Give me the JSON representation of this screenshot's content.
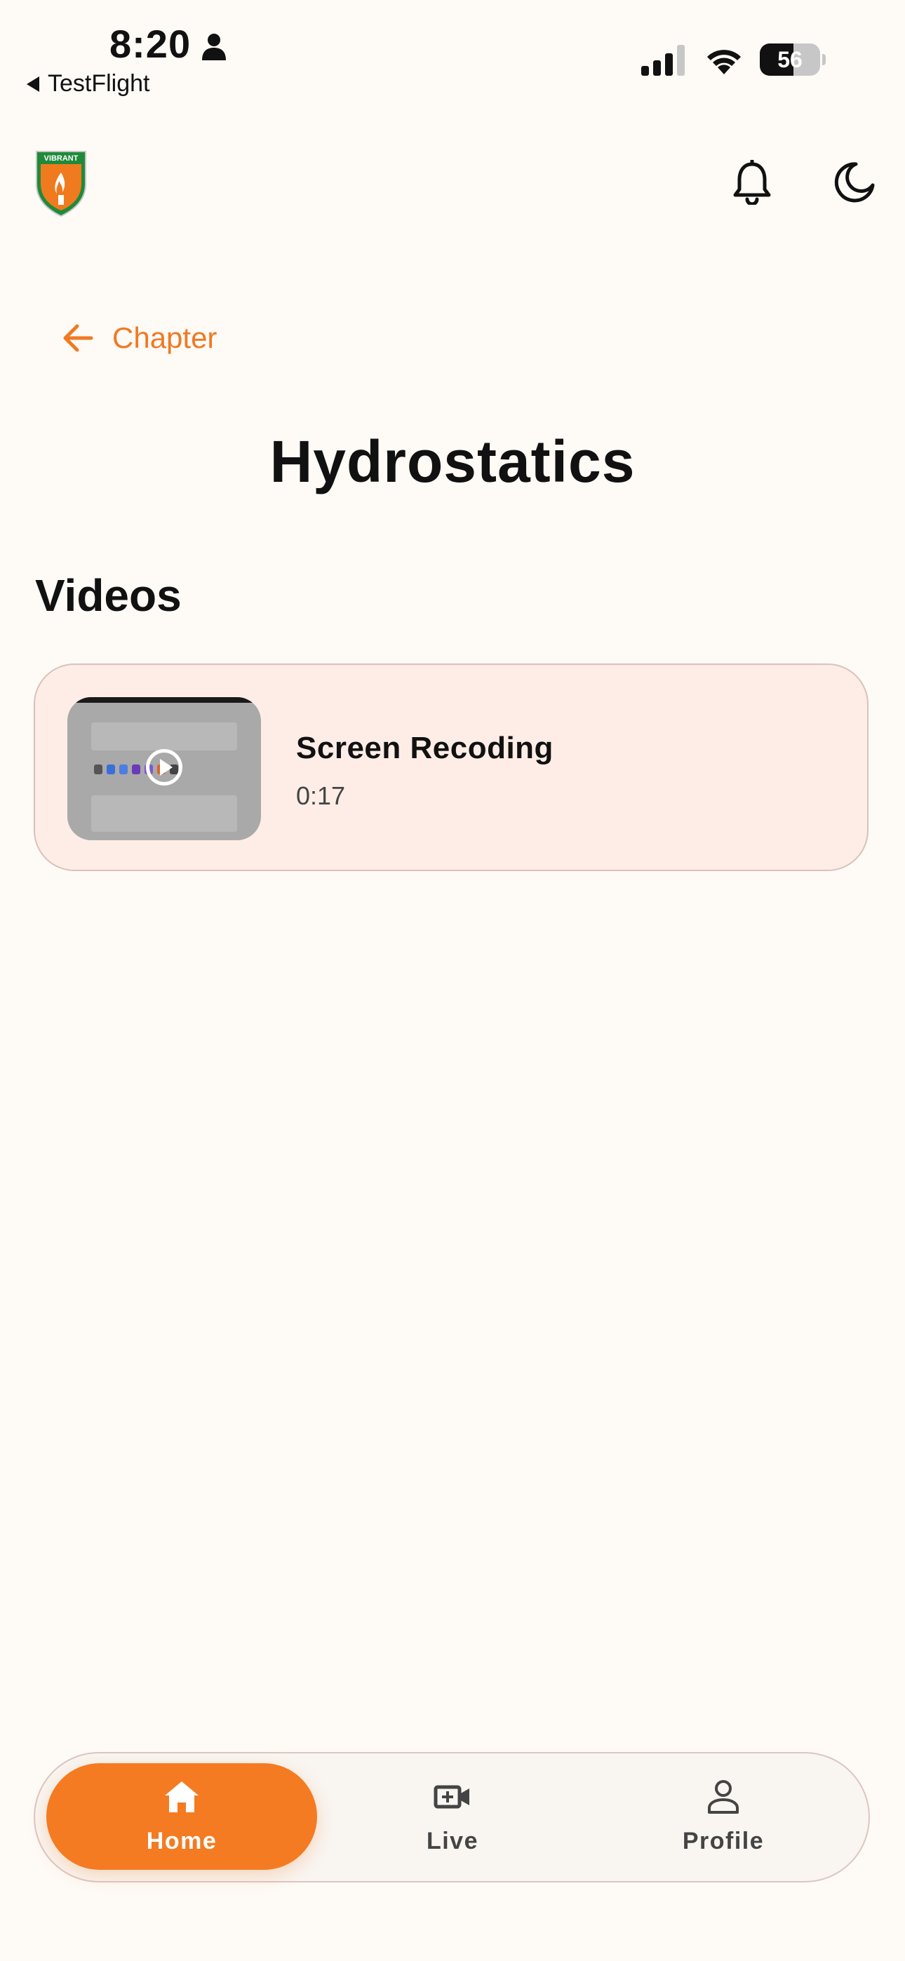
{
  "status_bar": {
    "time": "8:20",
    "back_app": "TestFlight",
    "battery_level": "56",
    "battery_fraction": 0.56
  },
  "header": {
    "logo_name": "vibrant-logo",
    "logo_text": "VIBRANT",
    "notification_icon": "bell-icon",
    "theme_icon": "moon-icon"
  },
  "back_link": {
    "label": "Chapter"
  },
  "page": {
    "title": "Hydrostatics",
    "section_title": "Videos"
  },
  "videos": [
    {
      "title": "Screen Recoding",
      "duration": "0:17"
    }
  ],
  "bottom_nav": {
    "items": [
      {
        "label": "Home",
        "icon": "home-icon",
        "active": true
      },
      {
        "label": "Live",
        "icon": "video-add-icon",
        "active": false
      },
      {
        "label": "Profile",
        "icon": "person-icon",
        "active": false
      }
    ]
  },
  "colors": {
    "accent": "#f47b22",
    "link": "#ef7a24",
    "background": "#fefaf6",
    "card_background": "#fdede6"
  }
}
